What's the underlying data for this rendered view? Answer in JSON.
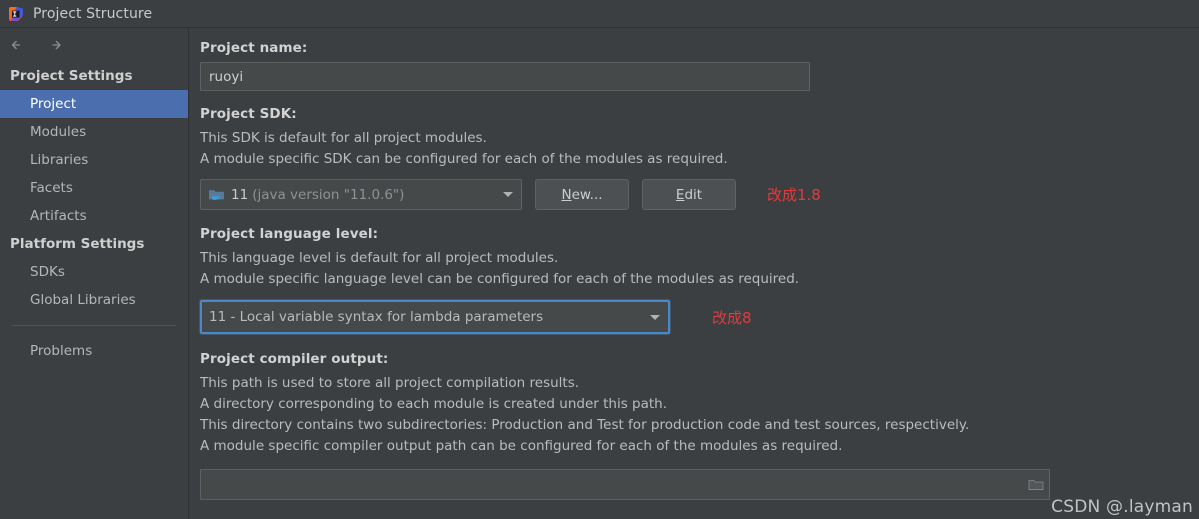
{
  "window": {
    "title": "Project Structure",
    "app_icon": "intellij-idea-logo"
  },
  "nav": {
    "back_icon": "arrow-left-icon",
    "forward_icon": "arrow-right-icon"
  },
  "sidebar": {
    "groups": [
      {
        "title": "Project Settings",
        "items": [
          {
            "label": "Project",
            "selected": true
          },
          {
            "label": "Modules",
            "selected": false
          },
          {
            "label": "Libraries",
            "selected": false
          },
          {
            "label": "Facets",
            "selected": false
          },
          {
            "label": "Artifacts",
            "selected": false
          }
        ]
      },
      {
        "title": "Platform Settings",
        "items": [
          {
            "label": "SDKs",
            "selected": false
          },
          {
            "label": "Global Libraries",
            "selected": false
          }
        ]
      }
    ],
    "extra_items": [
      {
        "label": "Problems",
        "selected": false
      }
    ]
  },
  "main": {
    "project_name": {
      "label": "Project name:",
      "value": "ruoyi",
      "placeholder": ""
    },
    "project_sdk": {
      "label": "Project SDK:",
      "descriptions": [
        "This SDK is default for all project modules.",
        "A module specific SDK can be configured for each of the modules as required."
      ],
      "selected_version": "11",
      "selected_detail": "(java version \"11.0.6\")",
      "icon": "jdk-folder-icon",
      "dropdown_icon": "chevron-down-icon",
      "new_button": {
        "label_before": "",
        "mnemonic": "N",
        "label_after": "ew..."
      },
      "edit_button": {
        "label_before": "",
        "mnemonic": "E",
        "label_after": "dit"
      },
      "annotation": "改成1.8"
    },
    "language_level": {
      "label": "Project language level:",
      "descriptions": [
        "This language level is default for all project modules.",
        "A module specific language level can be configured for each of the modules as required."
      ],
      "selected": "11 - Local variable syntax for lambda parameters",
      "dropdown_icon": "chevron-down-icon",
      "annotation": "改成8"
    },
    "compiler_output": {
      "label": "Project compiler output:",
      "descriptions": [
        "This path is used to store all project compilation results.",
        "A directory corresponding to each module is created under this path.",
        "This directory contains two subdirectories: Production and Test for production code and test sources, respectively.",
        "A module specific compiler output path can be configured for each of the modules as required."
      ],
      "value": "",
      "placeholder": "",
      "browse_icon": "folder-browse-icon"
    }
  },
  "watermark": {
    "text": "CSDN @.layman"
  },
  "colors": {
    "background": "#3c3f41",
    "selection": "#4b6eaf",
    "focus_ring": "#4a88c7",
    "annotation_red": "#e33a3a",
    "field_background": "#45494a",
    "text": "#bbbbbb"
  }
}
